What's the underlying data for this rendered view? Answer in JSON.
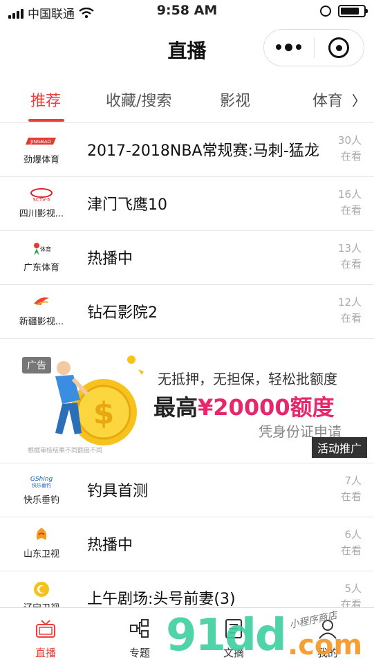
{
  "status": {
    "carrier": "中国联通",
    "time": "9:58 AM"
  },
  "nav": {
    "title": "直播"
  },
  "tabs": [
    {
      "label": "推荐",
      "active": true
    },
    {
      "label": "收藏/搜索"
    },
    {
      "label": "影视"
    },
    {
      "label": "体育"
    }
  ],
  "tab_more": "〉",
  "channels": [
    {
      "logo_text": "劲爆体育",
      "title": "2017-2018NBA常规赛:马刺-猛龙",
      "count": "30人",
      "status": "在看"
    },
    {
      "logo_text": "四川影视...",
      "title": "津门飞鹰10",
      "count": "16人",
      "status": "在看"
    },
    {
      "logo_text": "广东体育",
      "title": "热播中",
      "count": "13人",
      "status": "在看"
    },
    {
      "logo_text": "新疆影视...",
      "title": "钻石影院2",
      "count": "12人",
      "status": "在看"
    }
  ],
  "ad": {
    "tag": "广告",
    "line1": "无抵押，无担保，轻松批额度",
    "line2_prefix": "最高",
    "line2_amount": "¥20000额度",
    "line3": "凭身份证申请",
    "cta": "活动推广",
    "disclaimer": "根据审核结果不同额度不同"
  },
  "channels2": [
    {
      "logo_text": "快乐垂钓",
      "title": "钓具首测",
      "count": "7人",
      "status": "在看"
    },
    {
      "logo_text": "山东卫视",
      "title": "热播中",
      "count": "6人",
      "status": "在看"
    },
    {
      "logo_text": "辽宁卫视",
      "title": "上午剧场:头号前妻(3)",
      "count": "5人",
      "status": "在看"
    }
  ],
  "tabbar": [
    {
      "label": "直播",
      "icon": "tv-icon",
      "active": true
    },
    {
      "label": "专题",
      "icon": "topics-icon"
    },
    {
      "label": "文摘",
      "icon": "digest-icon"
    },
    {
      "label": "我的",
      "icon": "user-icon"
    }
  ],
  "watermark": {
    "text_main": "91dd",
    "text_sub": ".com",
    "text_cn": "小程序商店"
  },
  "colors": {
    "accent": "#e8413b",
    "ad_pink": "#e8276a",
    "watermark_green": "#3ecfa0",
    "watermark_orange": "#f59b2d"
  }
}
